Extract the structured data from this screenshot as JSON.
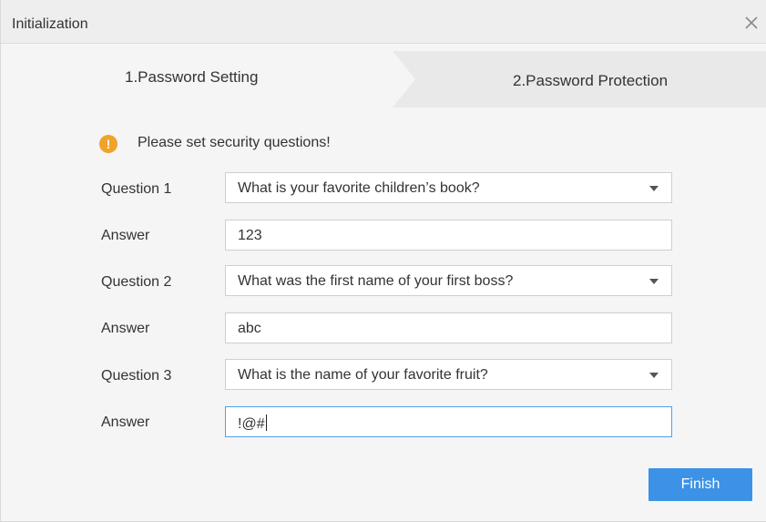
{
  "window": {
    "title": "Initialization"
  },
  "steps": [
    {
      "label": "1.Password Setting"
    },
    {
      "label": "2.Password Protection"
    }
  ],
  "notice": {
    "message": "Please set security questions!"
  },
  "form": {
    "question1": {
      "label": "Question 1",
      "value": "What is your favorite children’s book?"
    },
    "answer1": {
      "label": "Answer",
      "value": "123"
    },
    "question2": {
      "label": "Question 2",
      "value": "What was the first name of your first boss?"
    },
    "answer2": {
      "label": "Answer",
      "value": "abc"
    },
    "question3": {
      "label": "Question 3",
      "value": "What is the name of your favorite fruit?"
    },
    "answer3": {
      "label": "Answer",
      "value": "!@#"
    }
  },
  "actions": {
    "finish_label": "Finish"
  },
  "colors": {
    "accent": "#3b92e6",
    "warning": "#f0a22a",
    "focus_border": "#49a3f2"
  },
  "icons": {
    "close": "close-icon",
    "warning": "warning-icon",
    "dropdown": "chevron-down-icon"
  }
}
